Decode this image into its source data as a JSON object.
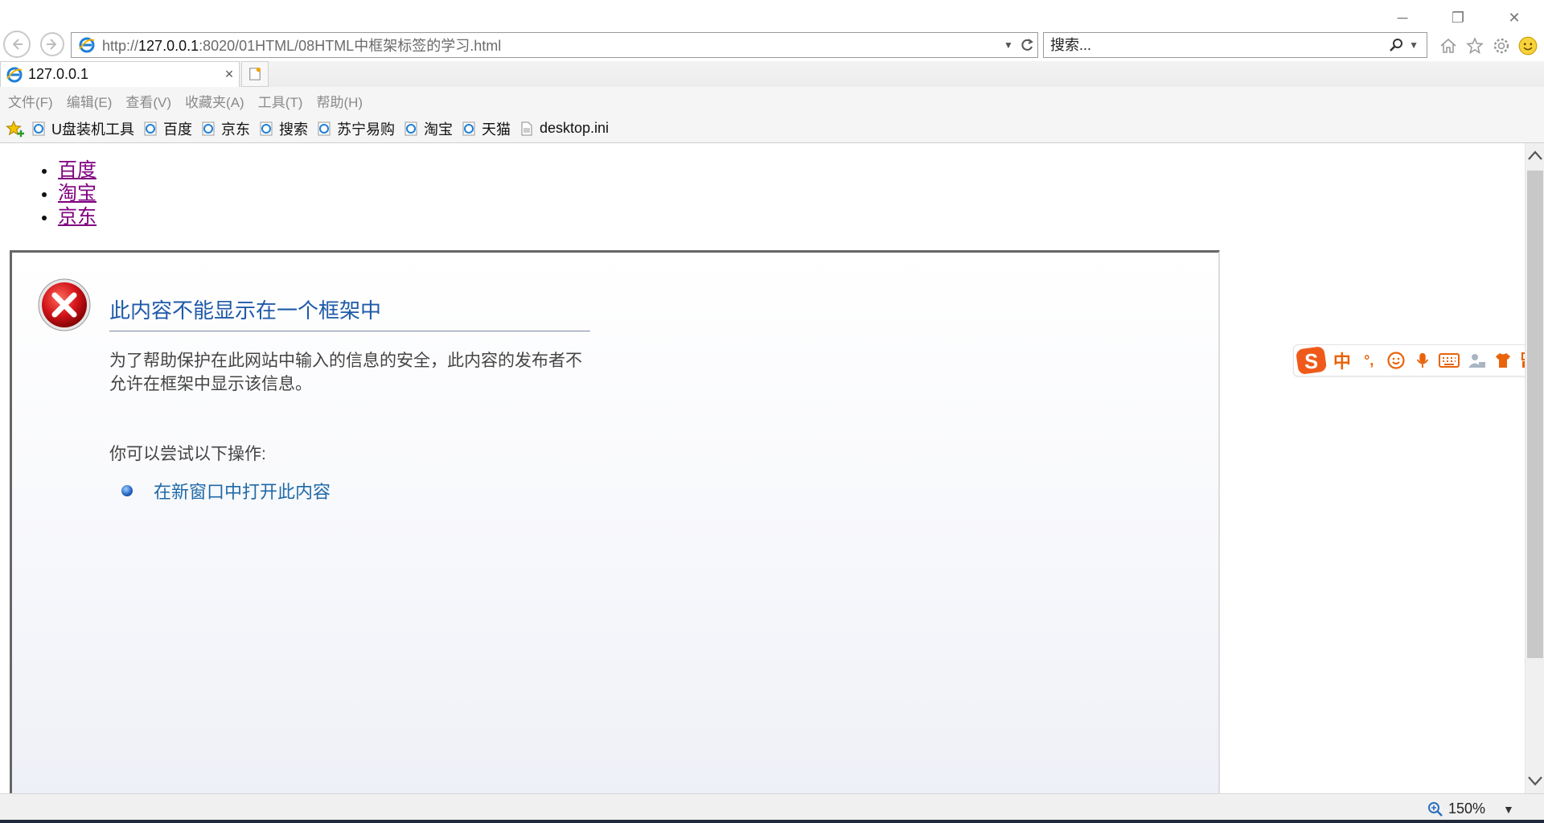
{
  "window": {
    "minimize": "─",
    "restore": "❐",
    "close": "✕"
  },
  "addressbar": {
    "url_prefix": "http://",
    "url_host": "127.0.0.1",
    "url_rest": ":8020/01HTML/08HTML中框架标签的学习.html"
  },
  "search": {
    "placeholder": "搜索..."
  },
  "tab": {
    "title": "127.0.0.1",
    "close": "×"
  },
  "menu": {
    "items": [
      "文件(F)",
      "编辑(E)",
      "查看(V)",
      "收藏夹(A)",
      "工具(T)",
      "帮助(H)"
    ]
  },
  "favorites": {
    "items": [
      "U盘装机工具",
      "百度",
      "京东",
      "搜索",
      "苏宁易购",
      "淘宝",
      "天猫",
      "desktop.ini"
    ]
  },
  "page": {
    "links": [
      "百度",
      "淘宝",
      "京东"
    ]
  },
  "iframe_error": {
    "title": "此内容不能显示在一个框架中",
    "description": "为了帮助保护在此网站中输入的信息的安全，此内容的发布者不允许在框架中显示该信息。",
    "try_label": "你可以尝试以下操作:",
    "action": "在新窗口中打开此内容"
  },
  "ime": {
    "items": [
      "中",
      "°,"
    ]
  },
  "status": {
    "zoom": "150%"
  },
  "colors": {
    "link_visited": "#800080",
    "error_title": "#1f5aa8",
    "ime_accent": "#e8630a"
  }
}
